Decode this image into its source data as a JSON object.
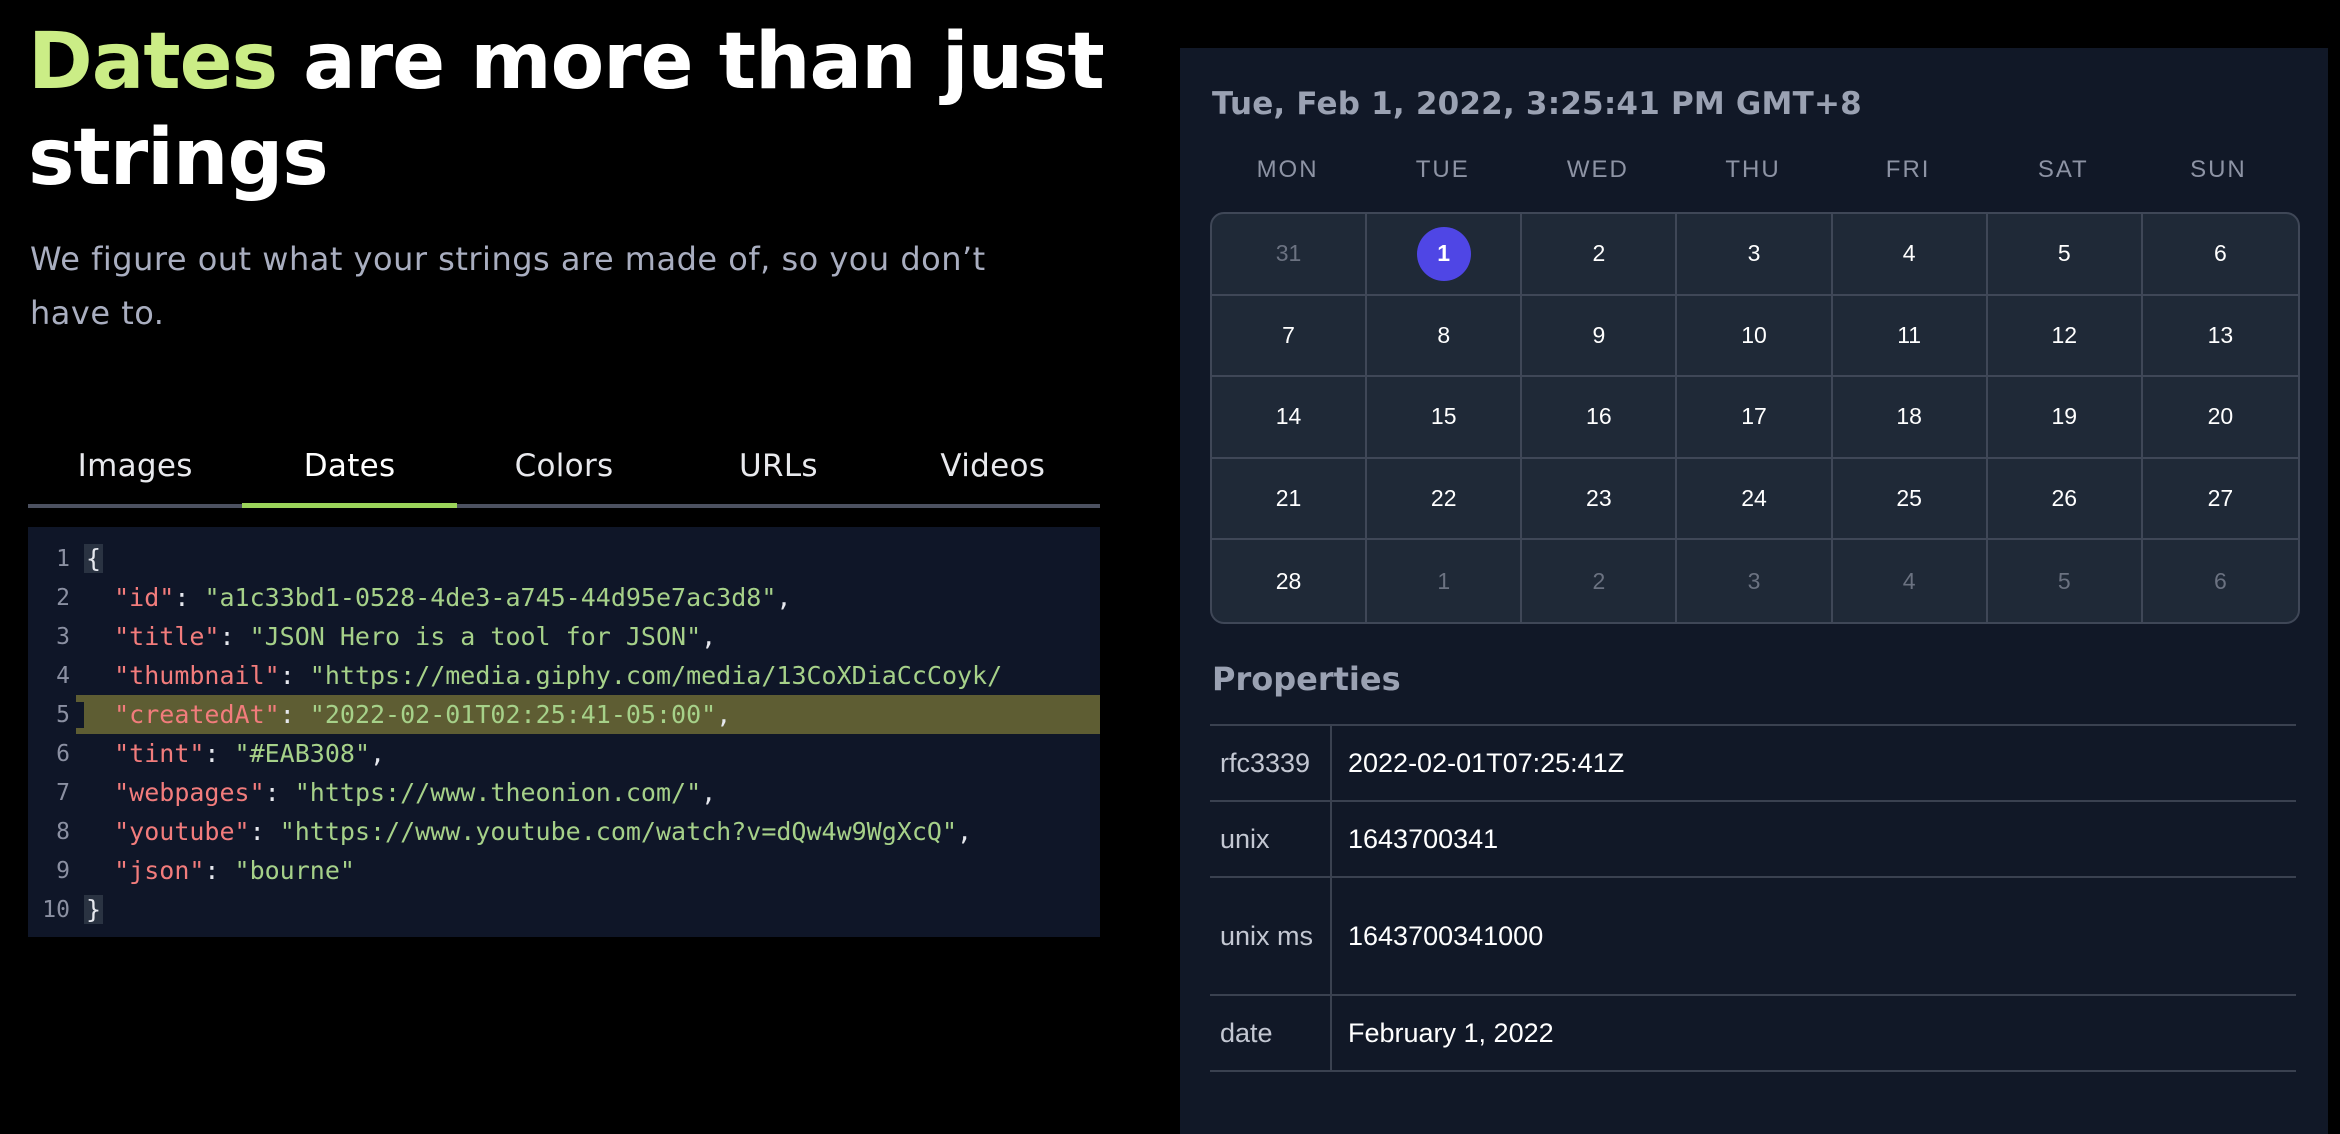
{
  "hero": {
    "title_accent": "Dates",
    "title_rest": "are more than just strings",
    "subtitle": "We figure out what your strings are made of, so you don’t have to."
  },
  "tabs": [
    {
      "label": "Images",
      "active": false
    },
    {
      "label": "Dates",
      "active": true
    },
    {
      "label": "Colors",
      "active": false
    },
    {
      "label": "URLs",
      "active": false
    },
    {
      "label": "Videos",
      "active": false
    }
  ],
  "code": {
    "highlighted_line": 5,
    "lines": [
      {
        "n": "1",
        "open": "{"
      },
      {
        "n": "2",
        "key": "\"id\"",
        "value": "\"a1c33bd1-0528-4de3-a745-44d95e7ac3d8\"",
        "comma": ","
      },
      {
        "n": "3",
        "key": "\"title\"",
        "value": "\"JSON Hero is a tool for JSON\"",
        "comma": ","
      },
      {
        "n": "4",
        "key": "\"thumbnail\"",
        "value": "\"https://media.giphy.com/media/13CoXDiaCcCoyk/",
        "comma": ""
      },
      {
        "n": "5",
        "key": "\"createdAt\"",
        "value": "\"2022-02-01T02:25:41-05:00\"",
        "comma": ","
      },
      {
        "n": "6",
        "key": "\"tint\"",
        "value": "\"#EAB308\"",
        "comma": ","
      },
      {
        "n": "7",
        "key": "\"webpages\"",
        "value": "\"https://www.theonion.com/\"",
        "comma": ","
      },
      {
        "n": "8",
        "key": "\"youtube\"",
        "value": "\"https://www.youtube.com/watch?v=dQw4w9WgXcQ\"",
        "comma": ","
      },
      {
        "n": "9",
        "key": "\"json\"",
        "value": "\"bourne\"",
        "comma": ""
      },
      {
        "n": "10",
        "close": "}"
      }
    ]
  },
  "panel": {
    "title": "Tue, Feb 1, 2022, 3:25:41 PM GMT+8",
    "weekdays": [
      "MON",
      "TUE",
      "WED",
      "THU",
      "FRI",
      "SAT",
      "SUN"
    ],
    "days": [
      {
        "d": "31",
        "muted": true
      },
      {
        "d": "1",
        "selected": true
      },
      {
        "d": "2"
      },
      {
        "d": "3"
      },
      {
        "d": "4"
      },
      {
        "d": "5"
      },
      {
        "d": "6"
      },
      {
        "d": "7"
      },
      {
        "d": "8"
      },
      {
        "d": "9"
      },
      {
        "d": "10"
      },
      {
        "d": "11"
      },
      {
        "d": "12"
      },
      {
        "d": "13"
      },
      {
        "d": "14"
      },
      {
        "d": "15"
      },
      {
        "d": "16"
      },
      {
        "d": "17"
      },
      {
        "d": "18"
      },
      {
        "d": "19"
      },
      {
        "d": "20"
      },
      {
        "d": "21"
      },
      {
        "d": "22"
      },
      {
        "d": "23"
      },
      {
        "d": "24"
      },
      {
        "d": "25"
      },
      {
        "d": "26"
      },
      {
        "d": "27"
      },
      {
        "d": "28"
      },
      {
        "d": "1",
        "muted": true
      },
      {
        "d": "2",
        "muted": true
      },
      {
        "d": "3",
        "muted": true
      },
      {
        "d": "4",
        "muted": true
      },
      {
        "d": "5",
        "muted": true
      },
      {
        "d": "6",
        "muted": true
      }
    ],
    "properties_title": "Properties",
    "properties": [
      {
        "key": "rfc3339",
        "value": "2022-02-01T07:25:41Z"
      },
      {
        "key": "unix",
        "value": "1643700341"
      },
      {
        "key": "unix ms",
        "value": "1643700341000"
      },
      {
        "key": "date",
        "value": "February 1, 2022"
      }
    ]
  },
  "colors": {
    "accent_green": "#cbed86",
    "tab_underline": "#9bd35a",
    "selected_day": "#4f46e5",
    "highlight_line": "#5e5d33",
    "json_key": "#f27c7c",
    "json_string": "#a6d189"
  }
}
